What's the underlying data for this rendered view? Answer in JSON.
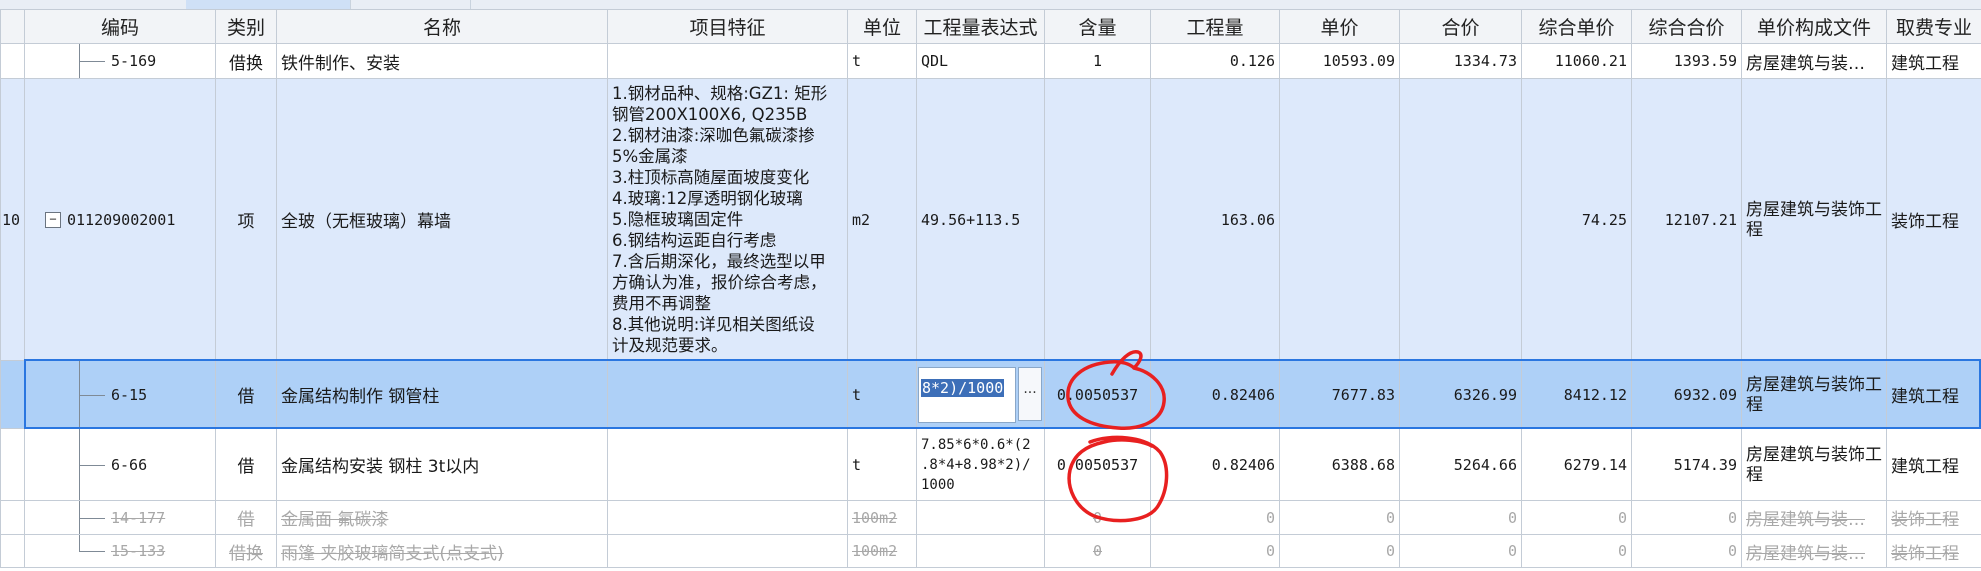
{
  "columns": {
    "blank": "",
    "code": "编码",
    "category": "类别",
    "name": "名称",
    "feature": "项目特征",
    "unit": "单位",
    "expr": "工程量表达式",
    "content": "含量",
    "qty": "工程量",
    "price": "单价",
    "total": "合价",
    "comp_price": "综合单价",
    "comp_total": "综合合价",
    "file": "单价构成文件",
    "major": "取费专业"
  },
  "rows": [
    {
      "idx": "",
      "code": "5-169",
      "category": "借换",
      "name": "铁件制作、安装",
      "feature": "",
      "unit": "t",
      "expr": "QDL",
      "content": "1",
      "qty": "0.126",
      "price": "10593.09",
      "total": "1334.73",
      "comp_price": "11060.21",
      "comp_total": "1393.59",
      "file": "房屋建筑与装…",
      "major": "建筑工程"
    },
    {
      "idx": "10",
      "toggle": "−",
      "code": "011209002001",
      "category": "项",
      "name": "全玻（无框玻璃）幕墙",
      "feature_lines": [
        "1.钢材品种、规格:GZ1: 矩形",
        "钢管200X100X6, Q235B",
        "2.钢材油漆:深咖色氟碳漆掺",
        "5%金属漆",
        "3.柱顶标高随屋面坡度变化",
        "4.玻璃:12厚透明钢化玻璃",
        "5.隐框玻璃固定件",
        "6.钢结构运距自行考虑",
        "7.含后期深化，最终选型以甲",
        "方确认为准，报价综合考虑，",
        "费用不再调整",
        "8.其他说明:详见相关图纸设",
        "计及规范要求。"
      ],
      "unit": "m2",
      "expr": "49.56+113.5",
      "content": "",
      "qty": "163.06",
      "price": "",
      "total": "",
      "comp_price": "74.25",
      "comp_total": "12107.21",
      "file": "房屋建筑与装饰工程",
      "major": "装饰工程"
    },
    {
      "idx": "",
      "code": "6-15",
      "category": "借",
      "name": "金属结构制作 钢管柱",
      "feature": "",
      "unit": "t",
      "expr": "8*2)/1000",
      "expr_button": "···",
      "content": "0.0050537",
      "qty": "0.82406",
      "price": "7677.83",
      "total": "6326.99",
      "comp_price": "8412.12",
      "comp_total": "6932.09",
      "file": "房屋建筑与装饰工程",
      "major": "建筑工程"
    },
    {
      "idx": "",
      "code": "6-66",
      "category": "借",
      "name": "金属结构安装 钢柱 3t以内",
      "feature": "",
      "unit": "t",
      "expr_lines": [
        "7.85*6*0.6*(2",
        ".8*4+8.98*2)/",
        "1000"
      ],
      "content": "0.0050537",
      "qty": "0.82406",
      "price": "6388.68",
      "total": "5264.66",
      "comp_price": "6279.14",
      "comp_total": "5174.39",
      "file": "房屋建筑与装饰工程",
      "major": "建筑工程"
    },
    {
      "idx": "",
      "code": "14-177",
      "category": "借",
      "name": "金属面 氟碳漆",
      "feature": "",
      "unit": "100m2",
      "expr": "",
      "content": "0",
      "qty": "0",
      "price": "0",
      "total": "0",
      "comp_price": "0",
      "comp_total": "0",
      "file": "房屋建筑与装…",
      "major": "装饰工程"
    },
    {
      "idx": "",
      "code": "15-133",
      "category": "借换",
      "name": "雨篷 夹胶玻璃简支式(点支式)",
      "feature": "",
      "unit": "100m2",
      "expr": "",
      "content": "0",
      "qty": "0",
      "price": "0",
      "total": "0",
      "comp_price": "0",
      "comp_total": "0",
      "file": "房屋建筑与装…",
      "major": "装饰工程"
    }
  ],
  "colors": {
    "selected_row": "#aed0f7",
    "group_row": "#dde9fb",
    "selection_border": "#2a76e0",
    "annotation": "#e82020"
  },
  "annotations": [
    "red-circle",
    "red-circle"
  ]
}
